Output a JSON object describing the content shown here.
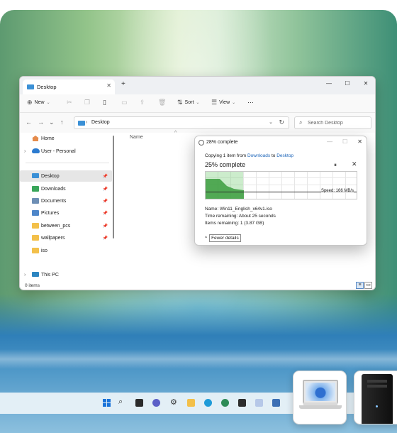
{
  "explorer": {
    "tab_title": "Desktop",
    "tab_close": "✕",
    "tab_add": "+",
    "window_controls": [
      "—",
      "☐",
      "✕"
    ],
    "toolbar": {
      "new_label": "New",
      "sort_label": "Sort",
      "view_label": "View",
      "more_label": "···"
    },
    "address": {
      "path": "Desktop",
      "separator": "›"
    },
    "search": {
      "placeholder": "Search Desktop"
    },
    "sidebar": {
      "items": [
        {
          "label": "Home",
          "icon": "home-icon"
        },
        {
          "label": "User - Personal",
          "icon": "cloud-icon"
        },
        {
          "label": "Desktop",
          "icon": "desktop-folder-icon",
          "pinned": true,
          "active": true
        },
        {
          "label": "Downloads",
          "icon": "downloads-folder-icon",
          "pinned": true
        },
        {
          "label": "Documents",
          "icon": "documents-folder-icon",
          "pinned": true
        },
        {
          "label": "Pictures",
          "icon": "pictures-folder-icon",
          "pinned": true
        },
        {
          "label": "between_pcs",
          "icon": "folder-icon",
          "pinned": true
        },
        {
          "label": "wallpapers",
          "icon": "folder-icon",
          "pinned": true
        },
        {
          "label": "iso",
          "icon": "folder-icon"
        },
        {
          "label": "This PC",
          "icon": "pc-icon"
        }
      ]
    },
    "column_name": "Name",
    "status_items": "0 items"
  },
  "copy_dialog": {
    "title": "28% complete",
    "copying_prefix": "Copying 1 item from",
    "source": "Downloads",
    "to_word": "to",
    "destination": "Desktop",
    "percent_text": "25% complete",
    "progress_percent": 25,
    "speed": "Speed: 166 MB/s",
    "name_line": "Name:  Win11_English_x64v1.iso",
    "time_line": "Time remaining:  About 25 seconds",
    "items_line": "Items remaining:  1 (3.87 GB)",
    "fewer_details": "Fewer details"
  },
  "colors": {
    "accent": "#1a73d9",
    "progress_green": "#4caf50",
    "link": "#1a63b8"
  }
}
